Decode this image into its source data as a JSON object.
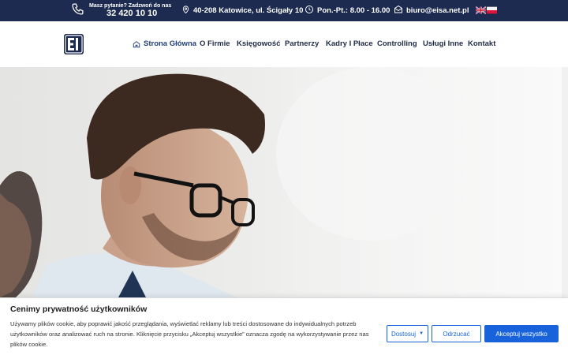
{
  "topbar": {
    "phone_question": "Masz pytanie? Zadzwoń do nas",
    "phone_number": "32 420 10 10",
    "address": "40-208 Katowice, ul. Ścigały 10",
    "hours": "Pon.-Pt.: 8.00 - 16.00",
    "email": "biuro@eisa.net.pl",
    "languages": [
      "english-flag-icon",
      "polish-flag-icon"
    ]
  },
  "nav": {
    "items": [
      {
        "label": "Strona Główna",
        "active": true
      },
      {
        "label": "O Firmie"
      },
      {
        "label": "Księgowość"
      },
      {
        "label": "Partnerzy"
      },
      {
        "label": "Kadry I Płace"
      },
      {
        "label": "Controlling"
      },
      {
        "label": "Usługi Inne"
      },
      {
        "label": "Kontakt"
      }
    ]
  },
  "cookie": {
    "title": "Cenimy prywatność użytkowników",
    "text": "Używamy plików cookie, aby poprawić jakość przeglądania, wyświetlać reklamy lub treści dostosowane do indywidualnych potrzeb użytkowników oraz analizować ruch na stronie. Kliknięcie przycisku „Akceptuj wszystkie” oznacza zgodę na wykorzystywanie przez nas plików cookie.",
    "customize_label": "Dostosuj",
    "reject_label": "Odrzucać",
    "accept_label": "Akceptuj wszystko"
  },
  "colors": {
    "topbar_bg": "#1c2b4f",
    "accent": "#1863dc",
    "nav_active": "#1f3f7a"
  }
}
